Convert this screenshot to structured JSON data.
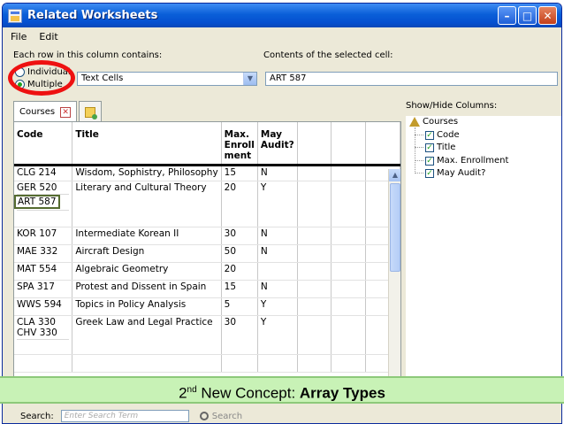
{
  "window": {
    "title": "Related Worksheets"
  },
  "menu": [
    "File",
    "Edit"
  ],
  "row_contains": {
    "label": "Each row in this column contains:",
    "options": [
      "Individual",
      "Multiple"
    ],
    "selected": "Multiple",
    "cell_type": "Text Cells"
  },
  "cell_contents": {
    "label": "Contents of the selected cell:",
    "value": "ART 587"
  },
  "tabs": {
    "courses": "Courses"
  },
  "table": {
    "headers": [
      "Code",
      "Title",
      "Max. Enroll ment",
      "May Audit?"
    ],
    "rows": [
      {
        "code": "CLG 214",
        "title": "Wisdom, Sophistry, Philosophy",
        "max": "15",
        "audit": "N"
      },
      {
        "code": "GER 520",
        "code2": "ART 587",
        "title": "Literary and Cultural Theory",
        "max": "20",
        "audit": "Y"
      },
      {
        "code": "KOR 107",
        "title": "Intermediate Korean II",
        "max": "30",
        "audit": "N"
      },
      {
        "code": "MAE 332",
        "title": "Aircraft Design",
        "max": "50",
        "audit": "N"
      },
      {
        "code": "MAT 554",
        "title": "Algebraic Geometry",
        "max": "20",
        "audit": ""
      },
      {
        "code": "SPA 317",
        "title": "Protest and Dissent in Spain",
        "max": "15",
        "audit": "N"
      },
      {
        "code": "WWS 594",
        "title": "Topics in Policy Analysis",
        "max": "5",
        "audit": "Y"
      },
      {
        "code": "CLA 330",
        "code2": "CHV 330",
        "title": "Greek Law and Legal Practice",
        "max": "30",
        "audit": "Y"
      }
    ]
  },
  "columns_panel": {
    "label": "Show/Hide Columns:",
    "root": "Courses",
    "items": [
      "Code",
      "Title",
      "Max. Enrollment",
      "May Audit?"
    ]
  },
  "banner": {
    "prefix": "2",
    "sup": "nd",
    "middle": " New Concept: ",
    "bold": "Array Types"
  },
  "search": {
    "label": "Search:",
    "placeholder": "Enter Search Term",
    "button": "Search"
  }
}
